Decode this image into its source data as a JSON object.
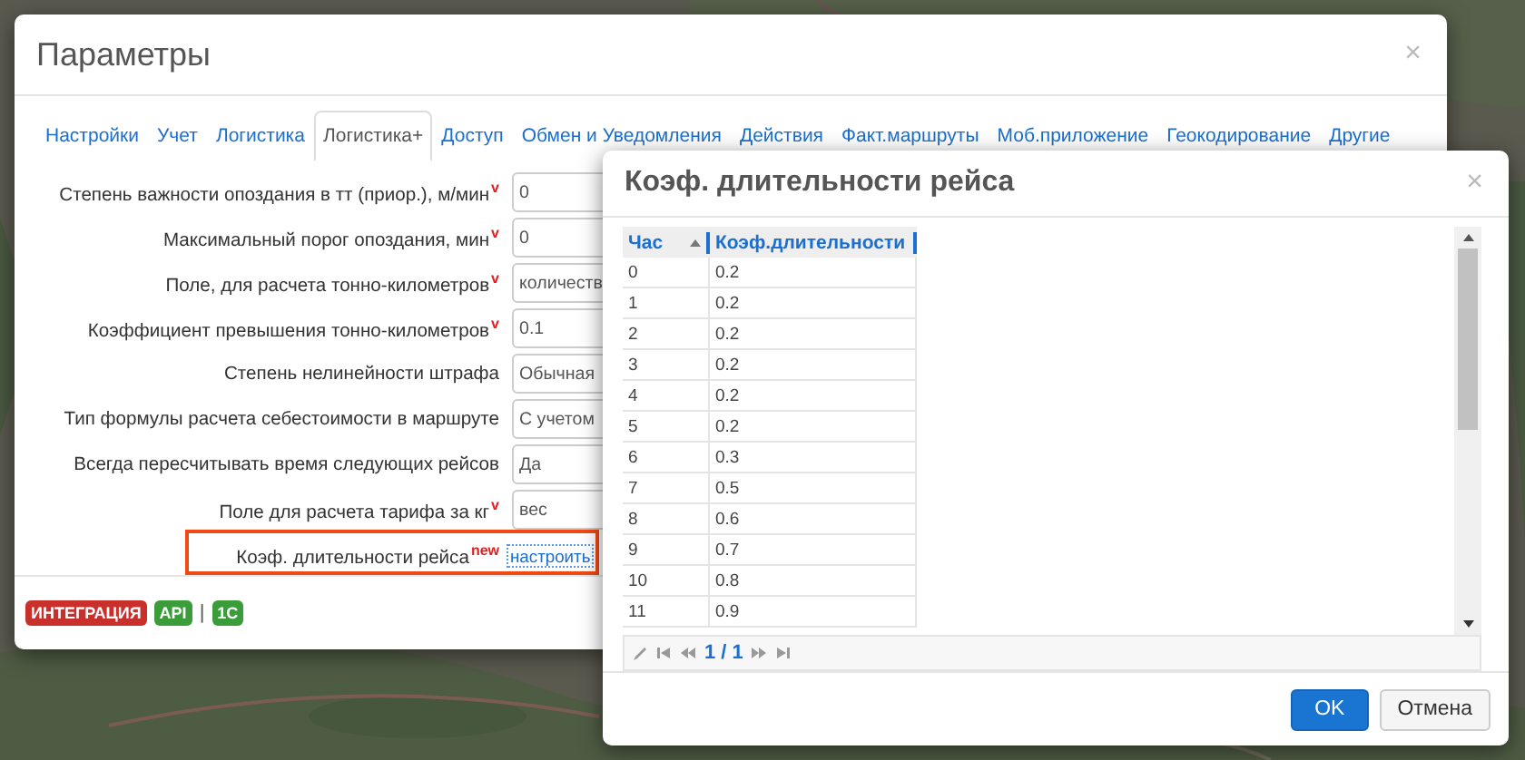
{
  "main_dialog": {
    "title": "Параметры",
    "close": "×",
    "tabs": [
      {
        "label": "Настройки",
        "selected": false
      },
      {
        "label": "Учет",
        "selected": false
      },
      {
        "label": "Логистика",
        "selected": false
      },
      {
        "label": "Логистика+",
        "selected": true
      },
      {
        "label": "Доступ",
        "selected": false
      },
      {
        "label": "Обмен и Уведомления",
        "selected": false
      },
      {
        "label": "Действия",
        "selected": false
      },
      {
        "label": "Факт.маршруты",
        "selected": false
      },
      {
        "label": "Моб.приложение",
        "selected": false
      },
      {
        "label": "Геокодирование",
        "selected": false
      },
      {
        "label": "Другие",
        "selected": false
      }
    ],
    "fields": [
      {
        "kind": "input",
        "label": "Степень важности опоздания в тт (приор.), м/мин",
        "mark": "v",
        "value": "0"
      },
      {
        "kind": "input",
        "label": "Максимальный порог опоздания, мин",
        "mark": "v",
        "value": "0"
      },
      {
        "kind": "input",
        "label": "Поле, для расчета тонно-километров",
        "mark": "v",
        "value": "количеств"
      },
      {
        "kind": "input",
        "label": "Коэффициент превышения тонно-километров",
        "mark": "v",
        "value": "0.1"
      },
      {
        "kind": "input",
        "label": "Степень нелинейности штрафа",
        "value": "Обычная"
      },
      {
        "kind": "input",
        "label": "Тип формулы расчета себестоимости в маршруте",
        "value": "С учетом"
      },
      {
        "kind": "input",
        "label": "Всегда пересчитывать время следующих рейсов",
        "value": "Да"
      },
      {
        "kind": "input",
        "label": "Поле для расчета тарифа за кг",
        "mark": "v",
        "value": "вес"
      },
      {
        "kind": "link",
        "label": "Коэф. длительности рейса",
        "new_mark": "new",
        "value": "настроить",
        "highlighted": true
      }
    ],
    "badges": [
      {
        "label": "ИНТЕГРАЦИЯ",
        "color": "#c9302c"
      },
      {
        "label": "API",
        "color": "#3a9d3a"
      },
      {
        "kind": "separator",
        "label": "|"
      },
      {
        "label": "1C",
        "color": "#3a9d3a"
      }
    ]
  },
  "coef_dialog": {
    "title": "Коэф. длительности рейса",
    "close": "×",
    "table": {
      "columns": [
        "Час",
        "Коэф.длительности"
      ],
      "rows": [
        [
          "0",
          "0.2"
        ],
        [
          "1",
          "0.2"
        ],
        [
          "2",
          "0.2"
        ],
        [
          "3",
          "0.2"
        ],
        [
          "4",
          "0.2"
        ],
        [
          "5",
          "0.2"
        ],
        [
          "6",
          "0.3"
        ],
        [
          "7",
          "0.5"
        ],
        [
          "8",
          "0.6"
        ],
        [
          "9",
          "0.7"
        ],
        [
          "10",
          "0.8"
        ],
        [
          "11",
          "0.9"
        ]
      ]
    },
    "pager": {
      "page": "1 / 1"
    },
    "buttons": [
      {
        "label": "OK",
        "primary": true
      },
      {
        "label": "Отмена",
        "primary": false
      }
    ]
  }
}
